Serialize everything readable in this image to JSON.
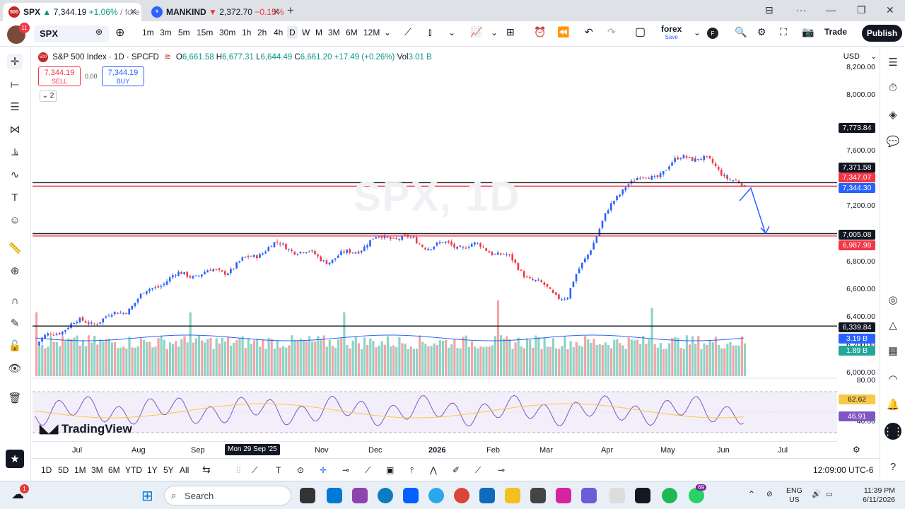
{
  "browser": {
    "tabs": [
      {
        "icon": "500",
        "label_sym": "SPX",
        "label_change_arrow": "▲",
        "label_price": "7,344.19",
        "label_change": "+1.06%",
        "label_suffix": "/ fore"
      },
      {
        "label_sym": "MANKIND",
        "label_change_arrow": "▼",
        "label_price": "2,372.70",
        "label_change": "−0.15%"
      }
    ]
  },
  "toolbar": {
    "avatar_badge": "11",
    "symbol": "SPX",
    "intervals": [
      "1m",
      "3m",
      "5m",
      "15m",
      "30m",
      "1h",
      "2h",
      "4h",
      "D",
      "W",
      "M",
      "3M",
      "6M",
      "12M"
    ],
    "active_interval": "D",
    "layout_name": "forex",
    "layout_save": "Save",
    "layout_badge": "F",
    "trade": "Trade",
    "publish": "Publish"
  },
  "legend": {
    "title": "S&P 500 Index · 1D · SPCFD",
    "o": "6,661.58",
    "h": "6,677.31",
    "l": "6,644.49",
    "c": "6,661.20",
    "chg": "+17.49 (+0.26%)",
    "vol": "3.01 B",
    "sell_price": "7,344.19",
    "sell": "SELL",
    "buy_price": "7,344.19",
    "buy": "BUY",
    "spread": "0.00",
    "layers": "2"
  },
  "watermark": "SPX, 1D",
  "yaxis": {
    "currency": "USD",
    "ticks": [
      "8,200.00",
      "8,000.00",
      "7,600.00",
      "7,200.00",
      "6,800.00",
      "6,600.00",
      "6,400.00",
      "6,200.00",
      "6,000.00"
    ],
    "labels": [
      {
        "text": "7,773.84",
        "color": "#131722"
      },
      {
        "text": "7,371.58",
        "color": "#131722"
      },
      {
        "text": "7,347.07",
        "color": "#f23645"
      },
      {
        "text": "7,344.30",
        "color": "#2962ff"
      },
      {
        "text": "7,005.08",
        "color": "#131722"
      },
      {
        "text": "6,987.98",
        "color": "#f23645"
      },
      {
        "text": "6,339.84",
        "color": "#131722"
      },
      {
        "text": "3.19 B",
        "color": "#2962ff"
      },
      {
        "text": "1.89 B",
        "color": "#26a69a"
      }
    ],
    "rsi_ticks": [
      "80.00",
      "40.00"
    ],
    "rsi_labels": [
      {
        "text": "62.62",
        "color": "#f7c948"
      },
      {
        "text": "46.91",
        "color": "#7e57c2"
      }
    ]
  },
  "xaxis": {
    "ticks": [
      "Jul",
      "Aug",
      "Sep",
      "Oct",
      "Nov",
      "Dec",
      "2026",
      "Feb",
      "Mar",
      "Apr",
      "May",
      "Jun",
      "Jul"
    ],
    "selected": "Mon 29 Sep '25"
  },
  "branding": "TradingView",
  "bottom": {
    "ranges": [
      "1D",
      "5D",
      "1M",
      "3M",
      "6M",
      "YTD",
      "1Y",
      "5Y",
      "All"
    ],
    "clock": "12:09:00 UTC-6"
  },
  "taskbar": {
    "search": "Search",
    "lang": "ENG",
    "region": "US",
    "time": "11:39 PM",
    "date": "6/11/2026",
    "whatsapp_badge": "69",
    "weather_badge": "1"
  },
  "chart_data": {
    "type": "candlestick",
    "title": "S&P 500 Index · 1D · SPCFD",
    "x": [
      "Jul",
      "Aug",
      "Sep",
      "Oct",
      "Nov",
      "Dec",
      "2026",
      "Feb",
      "Mar",
      "Apr",
      "May",
      "Jun"
    ],
    "close": [
      6200,
      6390,
      6600,
      6760,
      6880,
      6860,
      6950,
      6960,
      6800,
      6560,
      7380,
      7560,
      7344
    ],
    "ylim": [
      6000,
      8250
    ],
    "horizontal_levels": [
      7371.58,
      7347.07,
      7005.08,
      6987.98,
      6339.84
    ],
    "rsi": {
      "ylim": [
        25,
        85
      ],
      "bands": [
        70,
        30
      ]
    }
  }
}
